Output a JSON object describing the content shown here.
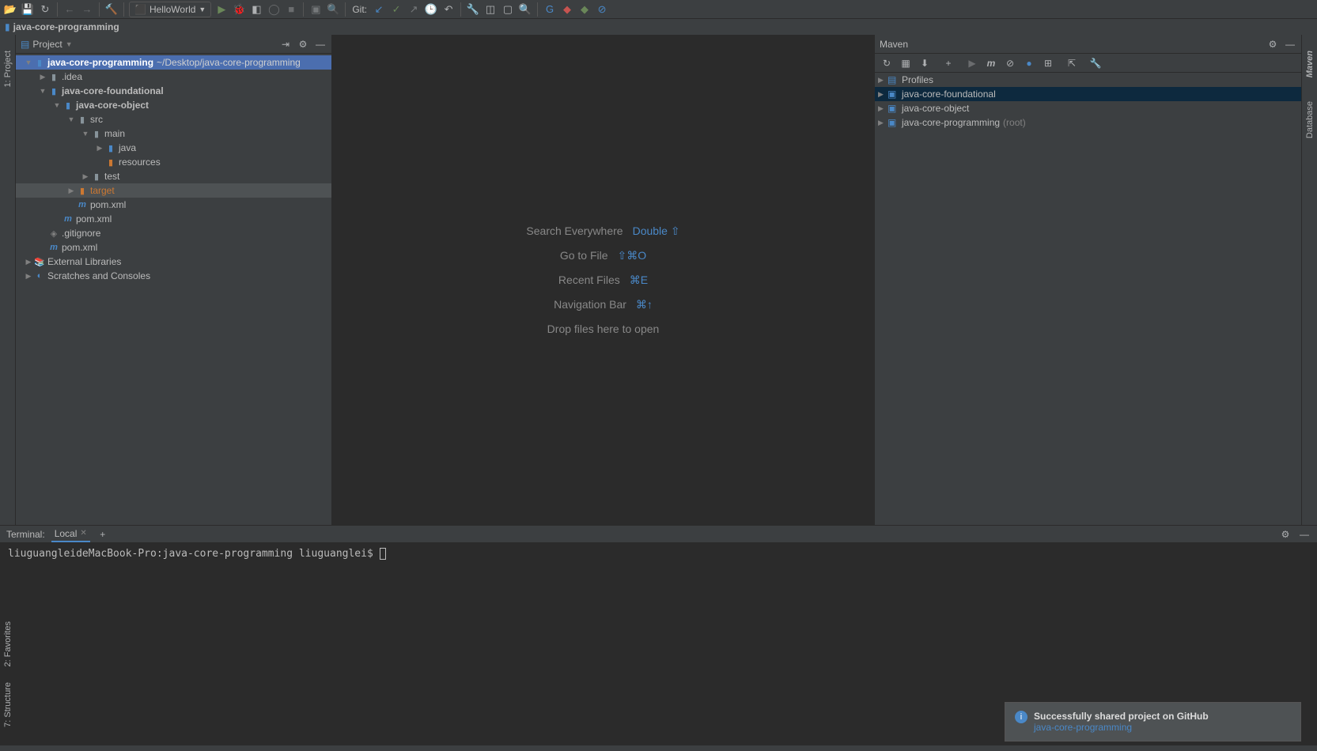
{
  "toolbar": {
    "run_config": "HelloWorld",
    "git_label": "Git:"
  },
  "breadcrumb": {
    "project": "java-core-programming"
  },
  "project_panel": {
    "title": "Project",
    "tree": {
      "root": "java-core-programming",
      "root_path": "~/Desktop/java-core-programming",
      "idea": ".idea",
      "foundational": "java-core-foundational",
      "object": "java-core-object",
      "src": "src",
      "main": "main",
      "java": "java",
      "resources": "resources",
      "test": "test",
      "target": "target",
      "pom1": "pom.xml",
      "pom2": "pom.xml",
      "gitignore": ".gitignore",
      "pom3": "pom.xml",
      "ext_libs": "External Libraries",
      "scratches": "Scratches and Consoles"
    }
  },
  "side_left": {
    "project": "1: Project"
  },
  "side_left_bottom": {
    "favorites": "2: Favorites",
    "structure": "7: Structure"
  },
  "side_right": {
    "maven": "Maven",
    "database": "Database"
  },
  "editor": {
    "search_label": "Search Everywhere",
    "search_key": "Double ⇧",
    "goto_label": "Go to File",
    "goto_key": "⇧⌘O",
    "recent_label": "Recent Files",
    "recent_key": "⌘E",
    "nav_label": "Navigation Bar",
    "nav_key": "⌘↑",
    "drop": "Drop files here to open"
  },
  "maven": {
    "title": "Maven",
    "profiles": "Profiles",
    "items": [
      "java-core-foundational",
      "java-core-object"
    ],
    "root_item": "java-core-programming",
    "root_suffix": "(root)"
  },
  "terminal": {
    "title": "Terminal:",
    "tab": "Local",
    "prompt": "liuguangleideMacBook-Pro:java-core-programming liuguanglei$ "
  },
  "notification": {
    "title": "Successfully shared project on GitHub",
    "link": "java-core-programming"
  }
}
